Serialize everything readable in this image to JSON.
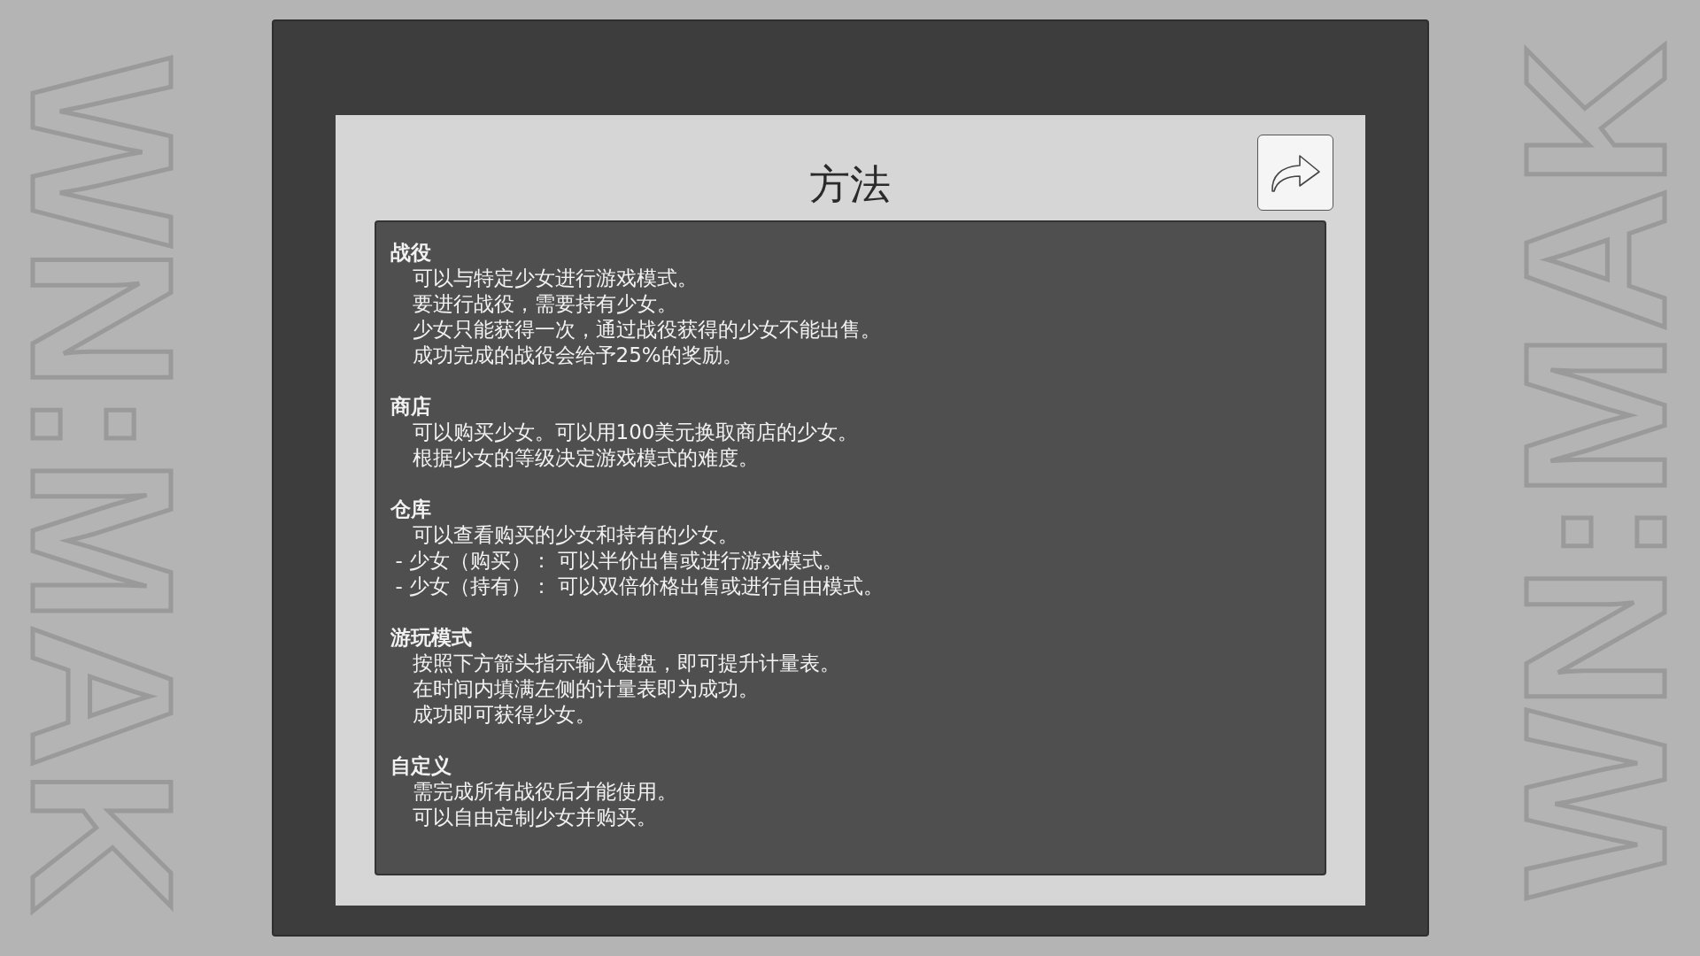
{
  "background_text": [
    "WN:MAK",
    "WN:MAK"
  ],
  "dialog": {
    "title": "方法",
    "sections": [
      {
        "heading": "战役",
        "lines": [
          {
            "kind": "indent",
            "text": "可以与特定少女进行游戏模式。"
          },
          {
            "kind": "indent",
            "text": "要进行战役，需要持有少女。"
          },
          {
            "kind": "indent",
            "text": "少女只能获得一次，通过战役获得的少女不能出售。"
          },
          {
            "kind": "indent",
            "text": "成功完成的战役会给予25%的奖励。"
          }
        ]
      },
      {
        "heading": "商店",
        "lines": [
          {
            "kind": "indent",
            "text": "可以购买少女。可以用100美元换取商店的少女。"
          },
          {
            "kind": "indent",
            "text": "根据少女的等级决定游戏模式的难度。"
          }
        ]
      },
      {
        "heading": "仓库",
        "lines": [
          {
            "kind": "indent",
            "text": "可以查看购买的少女和持有的少女。"
          },
          {
            "kind": "dash",
            "text": "- 少女（购买）： 可以半价出售或进行游戏模式。"
          },
          {
            "kind": "dash",
            "text": "- 少女（持有）： 可以双倍价格出售或进行自由模式。"
          }
        ]
      },
      {
        "heading": "游玩模式",
        "lines": [
          {
            "kind": "indent",
            "text": "按照下方箭头指示输入键盘，即可提升计量表。"
          },
          {
            "kind": "indent",
            "text": "在时间内填满左侧的计量表即为成功。"
          },
          {
            "kind": "indent",
            "text": "成功即可获得少女。"
          }
        ]
      },
      {
        "heading": "自定义",
        "lines": [
          {
            "kind": "indent",
            "text": "需完成所有战役后才能使用。"
          },
          {
            "kind": "indent",
            "text": "可以自由定制少女并购买。"
          }
        ]
      }
    ]
  }
}
